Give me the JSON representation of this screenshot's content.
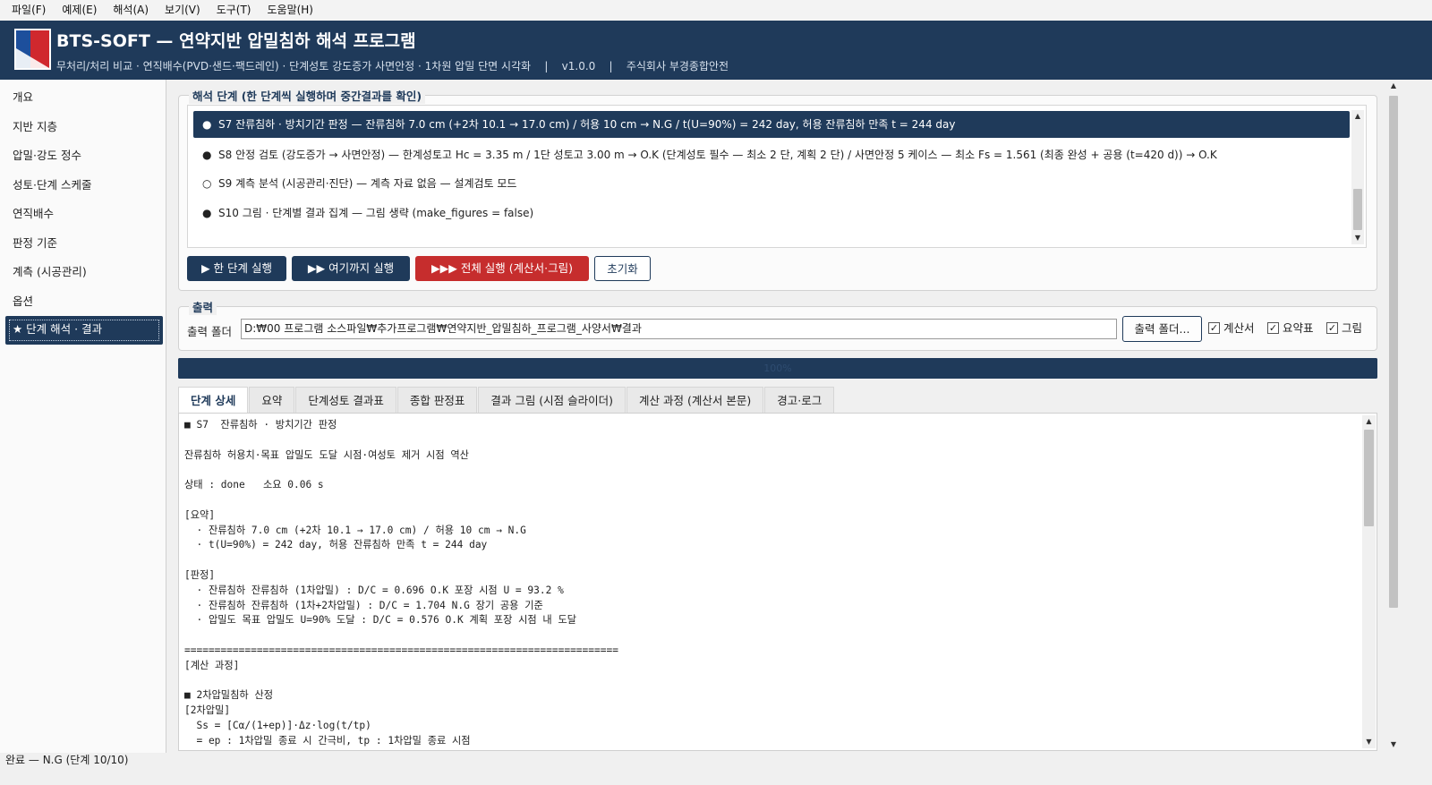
{
  "menu": [
    "파일(F)",
    "예제(E)",
    "해석(A)",
    "보기(V)",
    "도구(T)",
    "도움말(H)"
  ],
  "header": {
    "title": "BTS-SOFT — 연약지반 압밀침하 해석 프로그램",
    "subtitle": "무처리/처리 비교 · 연직배수(PVD·샌드·팩드레인) · 단계성토 강도증가 사면안정 · 1차원 압밀 단면 시각화    |    v1.0.0    |    주식회사 부경종합안전"
  },
  "sidebar": {
    "items": [
      "개요",
      "지반 지층",
      "압밀·강도 정수",
      "성토·단계 스케줄",
      "연직배수",
      "판정 기준",
      "계측 (시공관리)",
      "옵션",
      "★ 단계 해석 · 결과"
    ]
  },
  "steps_group": {
    "title": "해석 단계 (한 단계씩 실행하며 중간결과를 확인)",
    "steps": [
      {
        "dot": "●",
        "text": "S7  잔류침하 · 방치기간 판정   —  잔류침하 7.0 cm (+2차 10.1 → 17.0 cm) / 허용 10 cm → N.G / t(U=90%) = 242 day, 허용 잔류침하 만족 t = 244 day"
      },
      {
        "dot": "●",
        "text": "S8  안정 검토 (강도증가 → 사면안정)   —  한계성토고 Hc = 3.35 m / 1단 성토고 3.00 m → O.K (단계성토 필수 — 최소 2 단, 계획 2 단) / 사면안정 5 케이스 — 최소 Fs = 1.561 (최종 완성 + 공용 (t=420 d)) → O.K"
      },
      {
        "dot": "○",
        "text": "S9  계측 분석 (시공관리·진단)   —  계측 자료 없음 — 설계검토 모드"
      },
      {
        "dot": "●",
        "text": "S10  그림 · 단계별 결과 집계   —  그림 생략 (make_figures = false)"
      }
    ],
    "buttons": {
      "one_step": "▶ 한 단계 실행",
      "run_to_here": "▶▶ 여기까지 실행",
      "run_all": "▶▶▶ 전체 실행 (계산서·그림)",
      "reset": "초기화"
    }
  },
  "output_group": {
    "title": "출력",
    "folder_label": "출력 폴더",
    "folder_value": "D:₩00 프로그램 소스파일₩추가프로그램₩연약지반_압밀침하_프로그램_사양서₩결과",
    "browse_button": "출력 폴더...",
    "checks": [
      {
        "label": "계산서",
        "checked": "✓"
      },
      {
        "label": "요약표",
        "checked": "✓"
      },
      {
        "label": "그림",
        "checked": "✓"
      }
    ]
  },
  "progress": {
    "percent_text": "100%",
    "value": 1.0
  },
  "tabs": [
    "단계 상세",
    "요약",
    "단계성토 결과표",
    "종합 판정표",
    "결과 그림 (시점 슬라이더)",
    "계산 과정 (계산서 본문)",
    "경고·로그"
  ],
  "detail_text": "■ S7  잔류침하 · 방치기간 판정\n\n잔류침하 허용치·목표 압밀도 도달 시점·여성토 제거 시점 역산\n\n상태 : done   소요 0.06 s\n\n[요약]\n  · 잔류침하 7.0 cm (+2차 10.1 → 17.0 cm) / 허용 10 cm → N.G\n  · t(U=90%) = 242 day, 허용 잔류침하 만족 t = 244 day\n\n[판정]\n  · 잔류침하 잔류침하 (1차압밀) : D/C = 0.696 O.K 포장 시점 U = 93.2 %\n  · 잔류침하 잔류침하 (1차+2차압밀) : D/C = 1.704 N.G 장기 공용 기준\n  · 압밀도 목표 압밀도 U=90% 도달 : D/C = 0.576 O.K 계획 포장 시점 내 도달\n\n========================================================================\n[계산 과정]\n\n■ 2차압밀침하 산정\n[2차압밀]\n  Ss = [Cα/(1+ep)]·Δz·log(t/tp)\n  = ep : 1차압밀 종료 시 간극비, tp : 1차압밀 종료 시점",
  "status": "완료 — N.G (단계 10/10)",
  "colors": {
    "navy": "#1f3a5a",
    "red": "#c62d2d"
  }
}
